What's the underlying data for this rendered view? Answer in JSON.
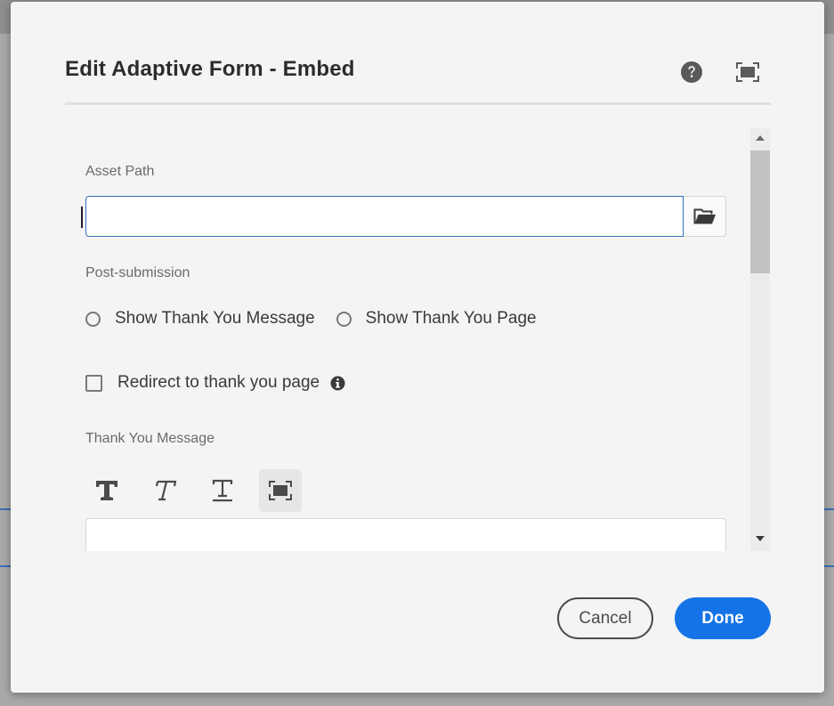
{
  "dialog": {
    "title": "Edit Adaptive Form - Embed",
    "help_icon": "help-circle-icon",
    "fullscreen_icon": "fullscreen-icon"
  },
  "asset_path": {
    "label": "Asset Path",
    "value": "",
    "placeholder": "",
    "browse_icon": "folder-open-icon"
  },
  "post_submission": {
    "label": "Post-submission",
    "options": [
      {
        "label": "Show Thank You Message",
        "selected": false
      },
      {
        "label": "Show Thank You Page",
        "selected": false
      }
    ]
  },
  "redirect": {
    "label": "Redirect to thank you page",
    "checked": false,
    "info_icon": "info-icon"
  },
  "thank_you_message": {
    "label": "Thank You Message",
    "toolbar": [
      {
        "icon": "bold-icon"
      },
      {
        "icon": "italic-icon"
      },
      {
        "icon": "underline-icon"
      },
      {
        "icon": "fullscreen-icon"
      }
    ],
    "value": ""
  },
  "footer": {
    "cancel_label": "Cancel",
    "done_label": "Done"
  },
  "colors": {
    "accent": "#1473e6",
    "input_focus_border": "#2d71b8",
    "dialog_bg": "#f4f4f4"
  }
}
